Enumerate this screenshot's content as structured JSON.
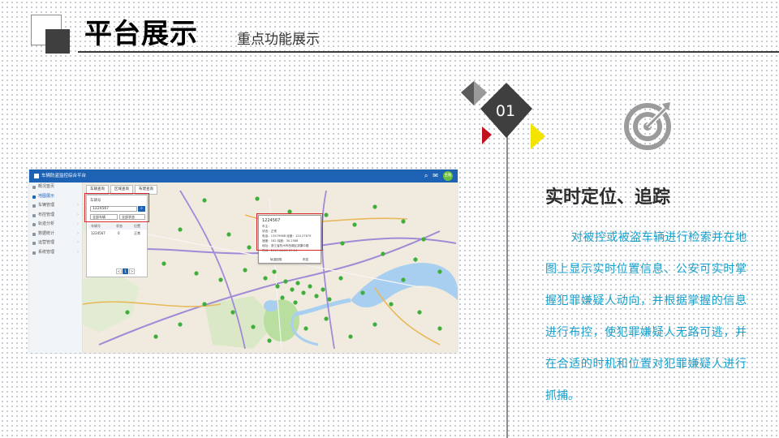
{
  "slide": {
    "title": "平台展示",
    "subtitle": "重点功能展示",
    "marker_number": "01",
    "feature_title": "实时定位、追踪",
    "feature_description": "对被控或被盗车辆进行检索并在地图上显示实时位置信息、公安可实时掌握犯罪嫌疑人动向，并根据掌握的信息进行布控，使犯罪嫌疑人无路可逃，并在合适的时机和位置对犯罪嫌疑人进行抓捕。",
    "icon": "target-icon",
    "colors": {
      "accent_text": "#17a0cc",
      "dark": "#3f3f3f",
      "red": "#c0121c",
      "yellow": "#f2e300"
    }
  },
  "app": {
    "title": "车辆防盗监控综合平台",
    "header_icons": [
      "search-icon",
      "mail-icon"
    ],
    "user_badge": "主账",
    "sidebar": [
      {
        "label": "概况首页",
        "active": false
      },
      {
        "label": "地图展示",
        "active": true
      },
      {
        "label": "车辆管理",
        "active": false
      },
      {
        "label": "布控管理",
        "active": false
      },
      {
        "label": "轨迹分析",
        "active": false
      },
      {
        "label": "数据统计",
        "active": false
      },
      {
        "label": "运营管理",
        "active": false
      },
      {
        "label": "系统管理",
        "active": false
      }
    ],
    "map_tabs": [
      "车辆查询",
      "区域查询",
      "布建查询"
    ],
    "search": {
      "label": "车辆号",
      "value": "1224567",
      "select1": "全部车辆",
      "select2": "全部状态",
      "columns": [
        "车辆号",
        "状态",
        "位置"
      ],
      "row": [
        "1224567",
        "0",
        "正常"
      ],
      "pages": [
        "<",
        "1",
        ">"
      ]
    },
    "popup": {
      "title": "1224567",
      "lines": [
        "车主：",
        "状态：正常",
        "电话：13579988    经度：120.27879",
        "速度：182         纬度：30.2588",
        "地址：浙江省杭州市西湖区滨康中路",
        "时间：2017-06-23 09:14"
      ],
      "buttons": [
        "轨迹回放",
        "布控"
      ]
    },
    "colors": {
      "header": "#1e62b4",
      "marker": "#3fae3a",
      "highlight_box": "#d9262c"
    }
  }
}
